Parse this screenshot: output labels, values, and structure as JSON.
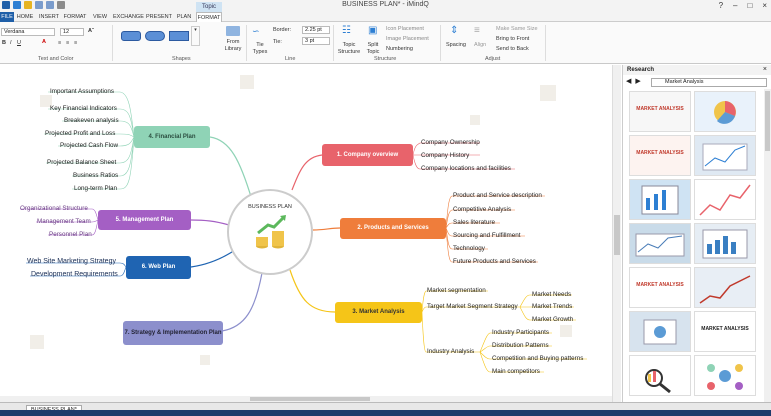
{
  "window": {
    "title": "BUSINESS PLAN* - iMindQ",
    "context_tab": "Topic"
  },
  "tabs": [
    "FILE",
    "HOME",
    "INSERT",
    "FORMAT",
    "VIEW",
    "EXCHANGE",
    "PRESENT",
    "PLAN",
    "FORMAT"
  ],
  "ribbon": {
    "font": "Verdana",
    "size": "12",
    "text_group": "Text and Color",
    "shapes_group": "Shapes",
    "from_library": "From Library",
    "tie_types": "Tie Types",
    "border_label": "Border:",
    "border_value": "2.25 pt",
    "tie_label": "Tie:",
    "tie_value": "3 pt",
    "line_group": "Line",
    "topic_structure": "Topic Structure",
    "split_topic": "Split Topic",
    "icon_placement": "Icon Placement",
    "image_placement": "Image Placement",
    "numbering": "Numbering",
    "structure_group": "Structure",
    "spacing": "Spacing",
    "align": "Align",
    "make_same_size": "Make Same Size",
    "bring_to_front": "Bring to Front",
    "send_to_back": "Send to Back",
    "adjust_group": "Adjust"
  },
  "map": {
    "center": "BUSINESS PLAN",
    "topics": {
      "company": "1. Company overview",
      "products": "2. Products and Services",
      "market": "3. Market Analysis",
      "financial": "4. Financial Plan",
      "management": "5. Management Plan",
      "web": "6. Web Plan",
      "strategy": "7. Strategy & Implementation Plan"
    },
    "financial_items": [
      "Important Assumptions",
      "Key Financial Indicators",
      "Breakeven analysis",
      "Projected Profit and Loss",
      "Projected Cash Flow",
      "Projected Balance Sheet",
      "Business Ratios",
      "Long-term Plan"
    ],
    "management_items": [
      "Organizational Structure",
      "Management Team",
      "Personnel Plan"
    ],
    "web_items": [
      "Web Site Marketing Strategy",
      "Development Requirements"
    ],
    "company_items": [
      "Company Ownership",
      "Company History",
      "Company locations and facilities"
    ],
    "products_items": [
      "Product and Service description",
      "Competitive Analysis",
      "Sales literature",
      "Sourcing and Fulfillment",
      "Technology",
      "Future Products and Services"
    ],
    "market_items": [
      "Market segmentation",
      "Target Market Segment Strategy",
      "Industry Analysis"
    ],
    "target_items": [
      "Market Needs",
      "Market Trends",
      "Market Growth"
    ],
    "industry_items": [
      "Industry Participants",
      "Distribution Patterns",
      "Competition and Buying patterns",
      "Main competitors"
    ]
  },
  "research": {
    "title": "Research",
    "close": "×",
    "query": "Market Analysis",
    "thumb_titles": [
      "MARKET ANALYSIS",
      "",
      "MARKET ANALYSIS",
      "",
      "",
      "",
      "",
      "",
      "MARKET ANALYSIS",
      "",
      "",
      "MARKET ANALYSIS",
      "",
      ""
    ]
  },
  "status": {
    "sheet": "BUSINESS PLAN*"
  },
  "colors": {
    "company": "#e8636b",
    "products": "#ef7d3b",
    "market": "#f5c518",
    "financial": "#8fd3b6",
    "management": "#a45fc4",
    "web": "#1f64b2",
    "strategy": "#8c8fcc"
  }
}
